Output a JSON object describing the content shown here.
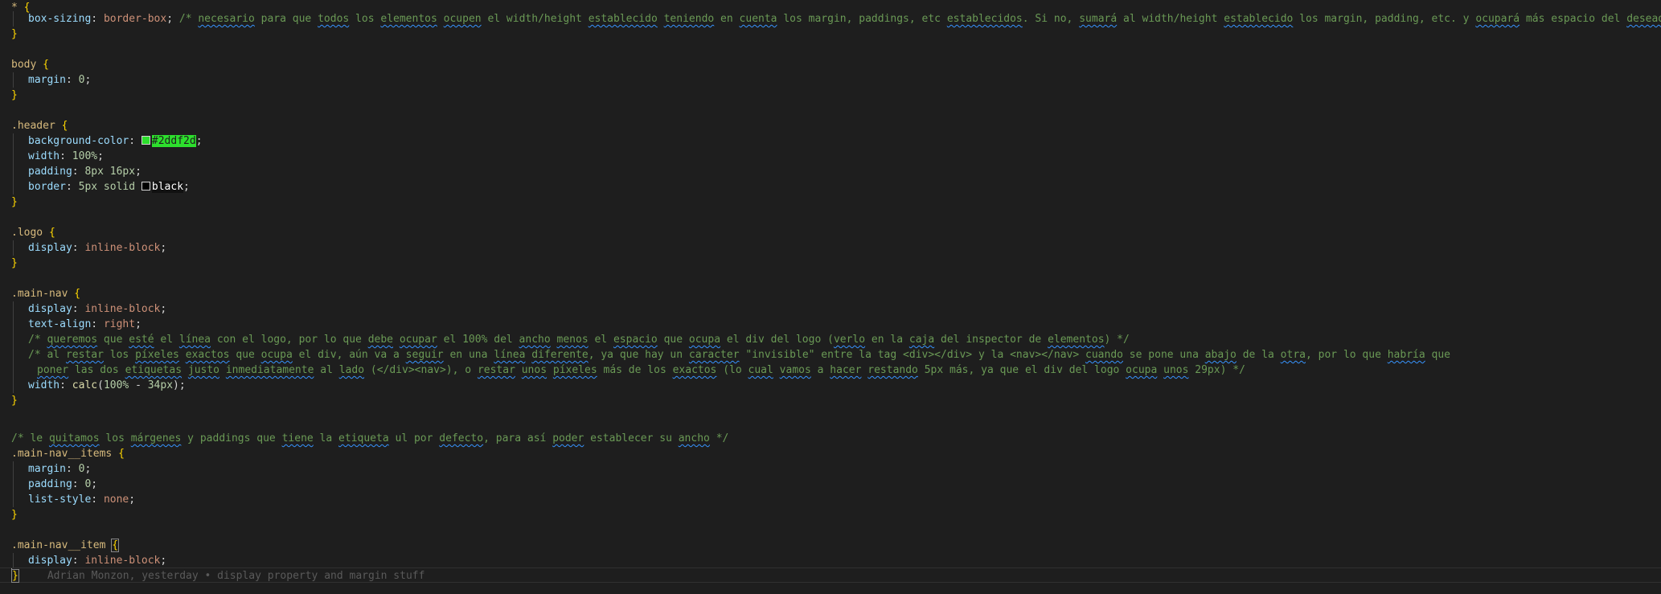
{
  "editor": {
    "theme_background": "#1e1e1e",
    "lines": {
      "l1": {
        "selector": "*",
        "open": "{"
      },
      "l2": {
        "prop": "box-sizing",
        "value": "border-box",
        "comment_a": "/* ",
        "w_necesario": "necesario",
        "c1": " para que ",
        "w_todos": "todos",
        "c2": " los ",
        "w_elementos": "elementos",
        "c3": " ",
        "w_ocupen": "ocupen",
        "c4": " el width/height ",
        "w_establecido": "establecido",
        "c5": " ",
        "w_teniendo": "teniendo",
        "c6": " en ",
        "w_cuenta": "cuenta",
        "c7": " los margin, paddings, etc ",
        "w_establecidos": "establecidos",
        "c8": ". Si no, ",
        "w_sumara": "sumará",
        "c9": " al width/height ",
        "w_establecido2": "establecido",
        "c10": " los margin, padding, etc. y ",
        "w_ocupara": "ocupará",
        "c11": " más espacio del ",
        "w_deseado": "deseado",
        "c12": " */"
      },
      "l3": {
        "close": "}"
      },
      "l5": {
        "selector": "body",
        "open": "{"
      },
      "l6": {
        "prop": "margin",
        "value": "0"
      },
      "l7": {
        "close": "}"
      },
      "l9": {
        "selector": ".header",
        "open": "{"
      },
      "l10": {
        "prop": "background-color",
        "value": "#2ddf2d",
        "swatch": "#2ddf2d"
      },
      "l11": {
        "prop": "width",
        "value": "100%"
      },
      "l12": {
        "prop": "padding",
        "value": "8px 16px"
      },
      "l13": {
        "prop": "border",
        "value_a": "5px solid ",
        "value_b": "black",
        "swatch": "#000000"
      },
      "l14": {
        "close": "}"
      },
      "l16": {
        "selector": ".logo",
        "open": "{"
      },
      "l17": {
        "prop": "display",
        "value": "inline-block"
      },
      "l18": {
        "close": "}"
      },
      "l20": {
        "selector": ".main-nav",
        "open": "{"
      },
      "l21": {
        "prop": "display",
        "value": "inline-block"
      },
      "l22": {
        "prop": "text-align",
        "value": "right"
      },
      "l23": {
        "c0": "/* ",
        "w_queremos": "queremos",
        "c1": " que ",
        "w_este": "esté",
        "c2": " el ",
        "w_linea": "línea",
        "c3": " con el logo, por lo que ",
        "w_debe": "debe",
        "c4": " ",
        "w_ocupar": "ocupar",
        "c5": " el 100% del ",
        "w_ancho": "ancho",
        "c6": " ",
        "w_menos": "menos",
        "c7": " el ",
        "w_espacio": "espacio",
        "c8": " que ",
        "w_ocupa": "ocupa",
        "c9": " el div del logo (",
        "w_verlo": "verlo",
        "c10": " en la ",
        "w_caja": "caja",
        "c11": " del inspector de ",
        "w_elementos": "elementos",
        "c12": ") */"
      },
      "l24": {
        "c0": "/* al ",
        "w_restar": "restar",
        "c1": " los ",
        "w_pixeles": "píxeles",
        "c2": " ",
        "w_exactos": "exactos",
        "c3": " que ",
        "w_ocupa": "ocupa",
        "c4": " el div, aún va a ",
        "w_seguir": "seguir",
        "c5": " en una ",
        "w_linea": "línea",
        "c6": " ",
        "w_diferente": "diferente",
        "c7": ", ya que hay un ",
        "w_caracter": "caracter",
        "c8": " \"invisible\" entre la tag <div></div> y la <nav></nav> ",
        "w_cuando": "cuando",
        "c9": " se pone una ",
        "w_abajo": "abajo",
        "c10": " de la ",
        "w_otra": "otra",
        "c11": ", por lo que ",
        "w_habria": "habría",
        "c12": " que"
      },
      "l25": {
        "w_poner": "poner",
        "c1": " las dos ",
        "w_etiquetas": "etiquetas",
        "c2": " ",
        "w_justo": "justo",
        "c3": " ",
        "w_inmediatamente": "inmediatamente",
        "c4": " al ",
        "w_lado": "lado",
        "c5": " (</div><nav>), o ",
        "w_restar": "restar",
        "c6": " ",
        "w_unos": "unos",
        "c7": " ",
        "w_pixeles": "píxeles",
        "c8": " más de los ",
        "w_exactos": "exactos",
        "c9": " (lo ",
        "w_cual": "cual",
        "c10": " ",
        "w_vamos": "vamos",
        "c11": " a ",
        "w_hacer": "hacer",
        "c12": " ",
        "w_restando": "restando",
        "c13": " 5px más, ya que el div del logo ",
        "w_ocupa": "ocupa",
        "c14": " ",
        "w_unos2": "unos",
        "c15": " 29px) */"
      },
      "l26": {
        "prop": "width",
        "func": "calc",
        "arg_open": "(",
        "num1": "100%",
        "op": " - ",
        "num2": "34px",
        "arg_close": ")"
      },
      "l27": {
        "close": "}"
      },
      "l29": {
        "c0": "/* le ",
        "w_quitamos": "quitamos",
        "c1": " los ",
        "w_margenes": "márgenes",
        "c2": " y paddings que ",
        "w_tiene": "tiene",
        "c3": " la ",
        "w_etiqueta": "etiqueta",
        "c4": " ul por ",
        "w_defecto": "defecto",
        "c5": ", para así ",
        "w_poder": "poder",
        "c6": " establecer su ",
        "w_ancho": "ancho",
        "c7": " */"
      },
      "l30": {
        "selector": ".main-nav__items",
        "open": "{"
      },
      "l31": {
        "prop": "margin",
        "value": "0"
      },
      "l32": {
        "prop": "padding",
        "value": "0"
      },
      "l33": {
        "prop": "list-style",
        "value": "none"
      },
      "l34": {
        "close": "}"
      },
      "l36": {
        "selector": ".main-nav__item",
        "open": "{"
      },
      "l37": {
        "prop": "display",
        "value": "inline-block"
      },
      "l38": {
        "close": "}",
        "blame": "Adrian Monzon, yesterday • display property and margin stuff"
      }
    }
  }
}
